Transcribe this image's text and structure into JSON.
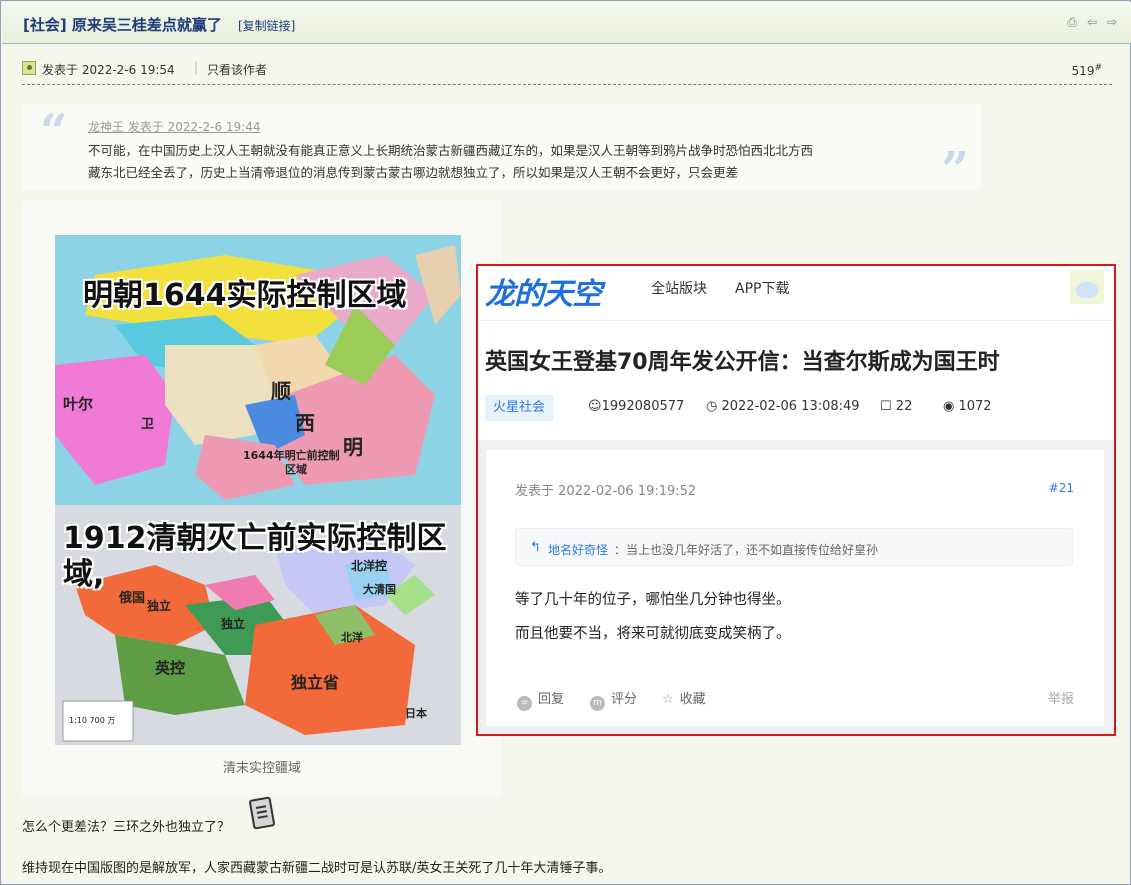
{
  "header": {
    "title": "[社会] 原来吴三桂差点就赢了",
    "copy_link": "[复制链接]",
    "icons": [
      "print-icon",
      "prev-icon",
      "next-icon"
    ]
  },
  "post": {
    "posted": "发表于 2022-2-6 19:54",
    "separator": "|",
    "only_author": "只看该作者",
    "floor": "519",
    "floor_mark": "#"
  },
  "quote": {
    "author": "龙神王 发表于 2022-2-6 19:44",
    "line1": "不可能，在中国历史上汉人王朝就没有能真正意义上长期统治蒙古新疆西藏辽东的，如果是汉人王朝等到鸦片战争时恐怕西北北方西",
    "line2": "藏东北已经全丢了，历史上当清帝退位的消息传到蒙古蒙古哪边就想独立了，所以如果是汉人王朝不会更好，只会更差"
  },
  "image": {
    "map1_title": "明朝1644实际控制区域",
    "map1_labels": [
      "顺",
      "西",
      "明",
      "1644年明亡前控制",
      "区域",
      "叶尔",
      "卫"
    ],
    "map2_title": "1912清朝灭亡前实际控制区域,",
    "map2_labels": [
      "俄国",
      "独立",
      "英控",
      "独立",
      "独立省",
      "北洋控",
      "大清国",
      "北洋",
      "日本"
    ],
    "scale": "1:10 700 万",
    "caption": "清末实控疆域"
  },
  "embed": {
    "logo": "龙的天空",
    "nav": [
      "全站版块",
      "APP下载"
    ],
    "title": "英国女王登基70周年发公开信：当查尔斯成为国王时",
    "tag": "火星社会",
    "author": "1992080577",
    "datetime": "2022-02-06 13:08:49",
    "comments": "22",
    "views": "1072",
    "card": {
      "posted": "发表于 2022-02-06 19:19:52",
      "floor": "#21",
      "quote_user": "地名好奇怪",
      "quote_text": "：当上也没几年好活了，还不如直接传位给好皇孙",
      "line1": "等了几十年的位子，哪怕坐几分钟也得坐。",
      "line2": "而且他要不当，将来可就彻底变成笑柄了。",
      "reply": "回复",
      "rate": "评分",
      "fav": "收藏",
      "report": "举报"
    }
  },
  "replies": {
    "line1": "怎么个更差法？三环之外也独立了？",
    "line2": "维持现在中国版图的是解放军，人家西藏蒙古新疆二战时可是认苏联/英女王关死了几十年大清锤子事。"
  },
  "colors": {
    "title": "#1d3c78",
    "accent_blue": "#2a7ae2",
    "embed_border": "#d7191c"
  }
}
